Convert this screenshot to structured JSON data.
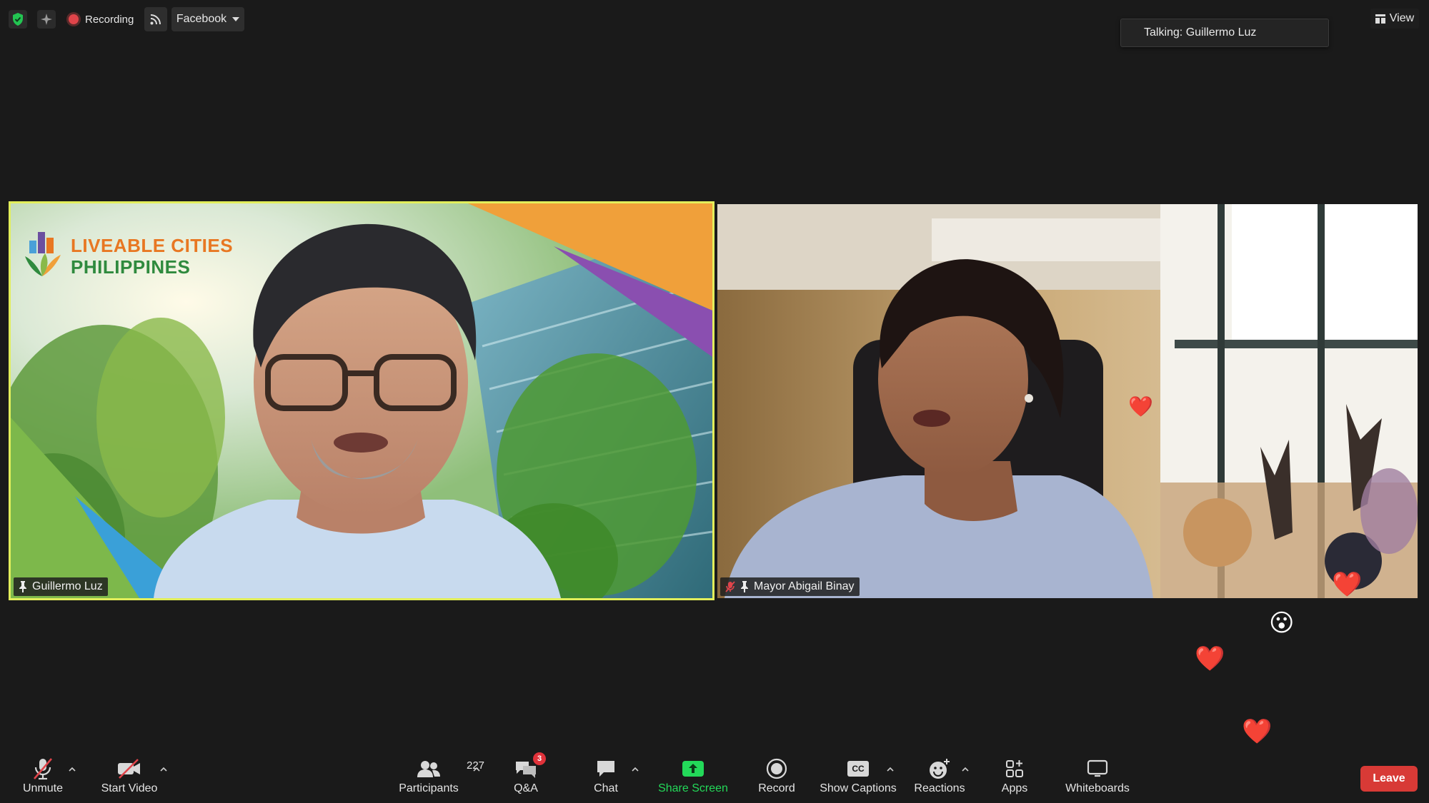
{
  "top_bar": {
    "recording_label": "Recording",
    "stream_platform": "Facebook",
    "talking_label": "Talking: Guillermo Luz",
    "view_label": "View"
  },
  "tiles": {
    "left": {
      "name": "Guillermo Luz",
      "background_logo_line1": "LIVEABLE CITIES",
      "background_logo_line2": "PHILIPPINES"
    },
    "right": {
      "name": "Mayor Abigail Binay"
    }
  },
  "toolbar": {
    "unmute_label": "Unmute",
    "start_video_label": "Start Video",
    "participants_label": "Participants",
    "participants_count": "227",
    "qa_label": "Q&A",
    "qa_badge": "3",
    "chat_label": "Chat",
    "share_screen_label": "Share Screen",
    "record_label": "Record",
    "captions_label": "Show Captions",
    "captions_icon_text": "CC",
    "reactions_label": "Reactions",
    "apps_label": "Apps",
    "whiteboards_label": "Whiteboards",
    "leave_label": "Leave"
  },
  "reactions": {
    "heart": "❤️",
    "wow": "😮"
  },
  "colors": {
    "background": "#1a1a1a",
    "active_speaker_border": "#e2ee5b",
    "share_green": "#23d959",
    "leave_red": "#d83a36",
    "badge_red": "#e0323a",
    "logo_orange": "#e87722",
    "logo_green": "#2f8a3e"
  },
  "icons": [
    "shield-check-icon",
    "sparkle-icon",
    "record-dot-icon",
    "live-stream-icon",
    "chevron-down-icon",
    "view-grid-icon",
    "pin-icon",
    "muted-mic-icon",
    "mic-off-icon",
    "video-off-icon",
    "chevron-up-icon",
    "participants-icon",
    "qa-icon",
    "chat-icon",
    "share-screen-icon",
    "record-icon",
    "captions-icon",
    "reactions-icon",
    "apps-icon",
    "whiteboard-icon",
    "heart-icon",
    "wow-emoji-icon"
  ]
}
